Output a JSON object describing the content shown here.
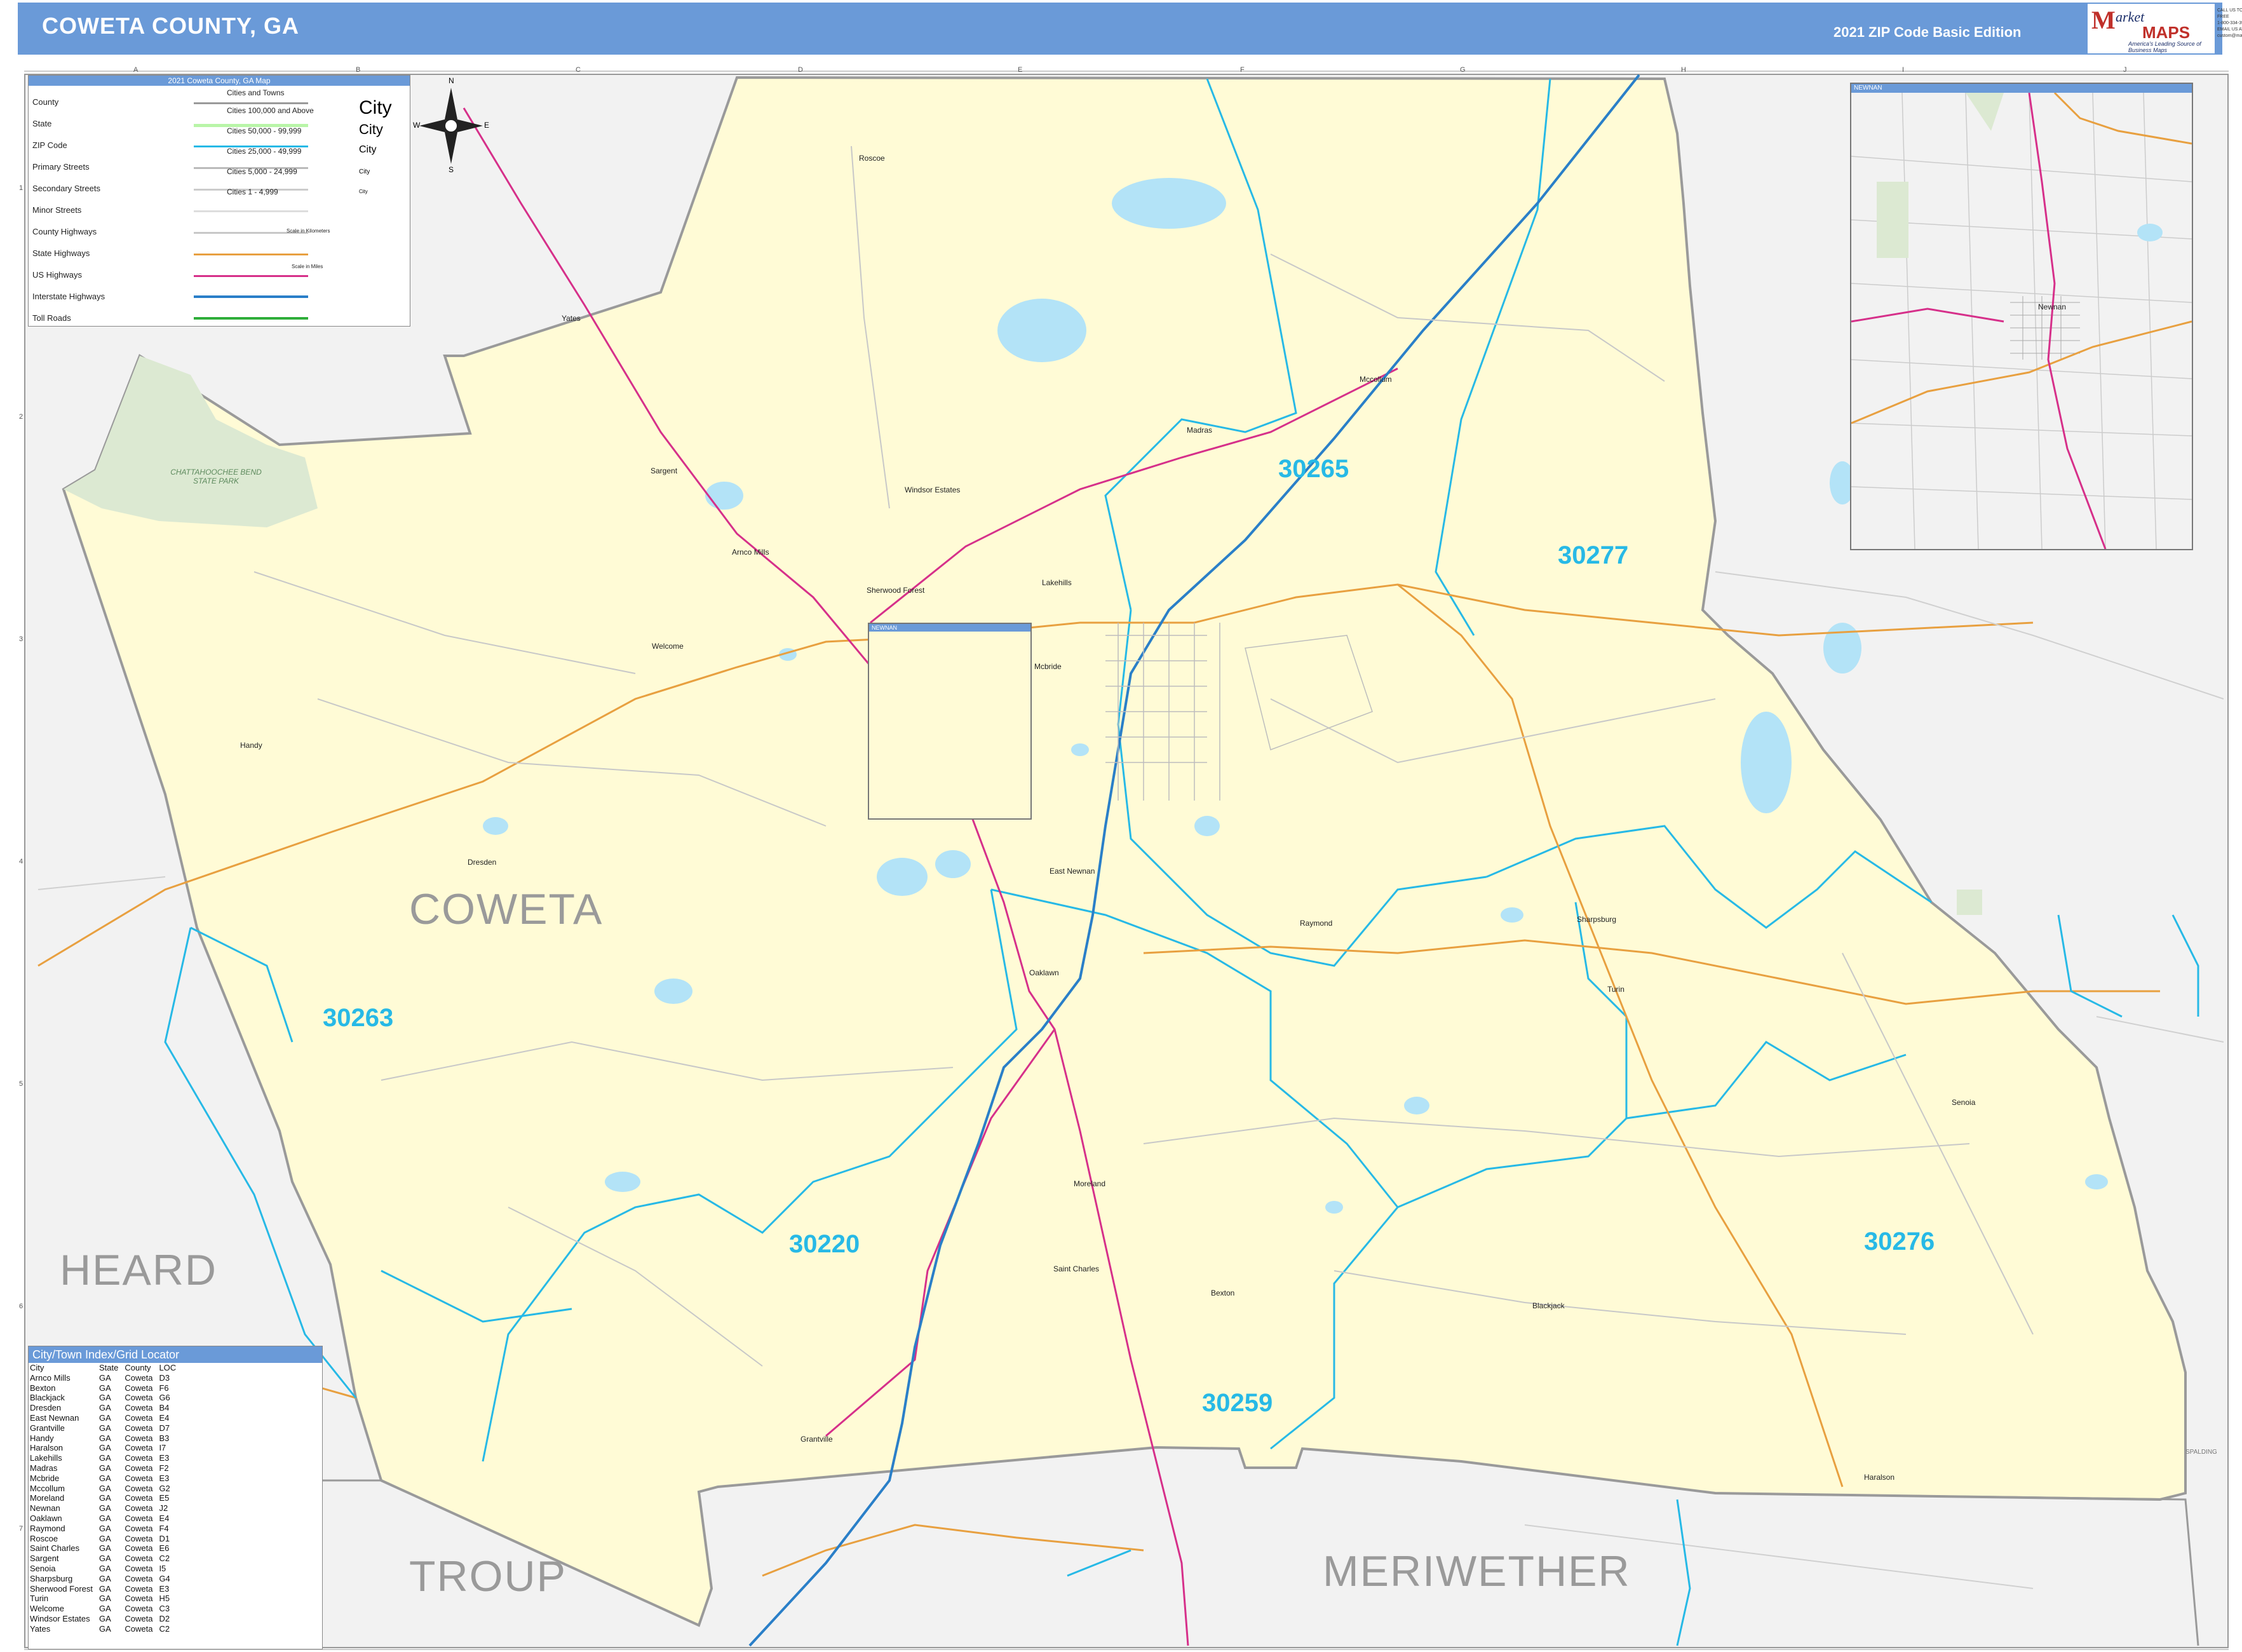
{
  "header": {
    "title": "COWETA COUNTY, GA",
    "edition": "2021 ZIP Code Basic Edition",
    "logo_m": "M",
    "logo_arket": "arket",
    "logo_maps": "MAPS",
    "logo_tagline": "America's Leading Source of Business Maps",
    "contact_lines": [
      "CALL US TOLL FREE",
      "1-800-334-3969",
      "EMAIL US AT",
      "custom@marketmaps.com"
    ]
  },
  "grid": {
    "columns": [
      "A",
      "B",
      "C",
      "D",
      "E",
      "F",
      "G",
      "H",
      "I",
      "J"
    ],
    "rows": [
      "1",
      "2",
      "3",
      "4",
      "5",
      "6",
      "7"
    ]
  },
  "legend": {
    "title": "2021 Coweta County, GA Map",
    "items": [
      {
        "label": "County",
        "color": "#9a9a9a"
      },
      {
        "label": "State",
        "color": "#b9f5a8"
      },
      {
        "label": "ZIP Code",
        "color": "#27b9e6"
      },
      {
        "label": "Primary Streets",
        "color": "#bbbbbb"
      },
      {
        "label": "Secondary Streets",
        "color": "#cccccc"
      },
      {
        "label": "Minor Streets",
        "color": "#dddddd"
      },
      {
        "label": "County Highways",
        "color": "#c8c8c8"
      },
      {
        "label": "State Highways",
        "color": "#e8a040"
      },
      {
        "label": "US Highways",
        "color": "#d6308a"
      },
      {
        "label": "Interstate Highways",
        "color": "#2a7fc8"
      },
      {
        "label": "Toll Roads",
        "color": "#2fae3a"
      }
    ],
    "cities_heading": "Cities and Towns",
    "cities": [
      {
        "label": "Cities 100,000 and Above",
        "sample": "City"
      },
      {
        "label": "Cities 50,000 - 99,999",
        "sample": "City"
      },
      {
        "label": "Cities 25,000 - 49,999",
        "sample": "City"
      },
      {
        "label": "Cities 5,000 - 24,999",
        "sample": "City"
      },
      {
        "label": "Cities 1 - 4,999",
        "sample": "City"
      }
    ],
    "scale_km": "Scale in Kilometers",
    "scale_mi": "Scale in Miles"
  },
  "compass": {
    "n": "N",
    "s": "S",
    "e": "E",
    "w": "W"
  },
  "inset": {
    "title": "NEWNAN",
    "city": "Newnan"
  },
  "inset2": {
    "title": "NEWNAN"
  },
  "counties": [
    "COWETA",
    "HEARD",
    "TROUP",
    "MERIWETHER"
  ],
  "neighbor_small": [
    "SPALDING"
  ],
  "zips": [
    "30265",
    "30277",
    "30263",
    "30220",
    "30276",
    "30259"
  ],
  "park": {
    "name": "CHATTAHOOCHEE BEND STATE PARK"
  },
  "places": [
    "Roscoe",
    "Yates",
    "Sargent",
    "Arnco Mills",
    "Welcome",
    "Handy",
    "Dresden",
    "Windsor Estates",
    "Sherwood Forest",
    "Madras",
    "Mccollum",
    "Lakehills",
    "Mcbride",
    "East Newnan",
    "Raymond",
    "Sharpsburg",
    "Turin",
    "Oaklawn",
    "Moreland",
    "Saint Charles",
    "Bexton",
    "Blackjack",
    "Senoia",
    "Grantville",
    "Haralson"
  ],
  "index": {
    "title": "City/Town Index/Grid Locator",
    "headers": [
      "City",
      "State",
      "County",
      "LOC"
    ],
    "rows": [
      [
        "Arnco Mills",
        "GA",
        "Coweta",
        "D3"
      ],
      [
        "Bexton",
        "GA",
        "Coweta",
        "F6"
      ],
      [
        "Blackjack",
        "GA",
        "Coweta",
        "G6"
      ],
      [
        "Dresden",
        "GA",
        "Coweta",
        "B4"
      ],
      [
        "East Newnan",
        "GA",
        "Coweta",
        "E4"
      ],
      [
        "Grantville",
        "GA",
        "Coweta",
        "D7"
      ],
      [
        "Handy",
        "GA",
        "Coweta",
        "B3"
      ],
      [
        "Haralson",
        "GA",
        "Coweta",
        "I7"
      ],
      [
        "Lakehills",
        "GA",
        "Coweta",
        "E3"
      ],
      [
        "Madras",
        "GA",
        "Coweta",
        "F2"
      ],
      [
        "Mcbride",
        "GA",
        "Coweta",
        "E3"
      ],
      [
        "Mccollum",
        "GA",
        "Coweta",
        "G2"
      ],
      [
        "Moreland",
        "GA",
        "Coweta",
        "E5"
      ],
      [
        "Newnan",
        "GA",
        "Coweta",
        "J2"
      ],
      [
        "Oaklawn",
        "GA",
        "Coweta",
        "E4"
      ],
      [
        "Raymond",
        "GA",
        "Coweta",
        "F4"
      ],
      [
        "Roscoe",
        "GA",
        "Coweta",
        "D1"
      ],
      [
        "Saint Charles",
        "GA",
        "Coweta",
        "E6"
      ],
      [
        "Sargent",
        "GA",
        "Coweta",
        "C2"
      ],
      [
        "Senoia",
        "GA",
        "Coweta",
        "I5"
      ],
      [
        "Sharpsburg",
        "GA",
        "Coweta",
        "G4"
      ],
      [
        "Sherwood Forest",
        "GA",
        "Coweta",
        "E3"
      ],
      [
        "Turin",
        "GA",
        "Coweta",
        "H5"
      ],
      [
        "Welcome",
        "GA",
        "Coweta",
        "C3"
      ],
      [
        "Windsor Estates",
        "GA",
        "Coweta",
        "D2"
      ],
      [
        "Yates",
        "GA",
        "Coweta",
        "C2"
      ]
    ]
  },
  "colors": {
    "county_fill": "#fffbd6",
    "neighbor_fill": "#f2f2f2",
    "water": "#b3e3f7",
    "park": "#dce9d2",
    "zip_line": "#27b9e6",
    "interstate": "#2a7fc8",
    "us_highway": "#d6308a",
    "state_highway": "#e8a040",
    "county_line": "#9a9a9a"
  }
}
